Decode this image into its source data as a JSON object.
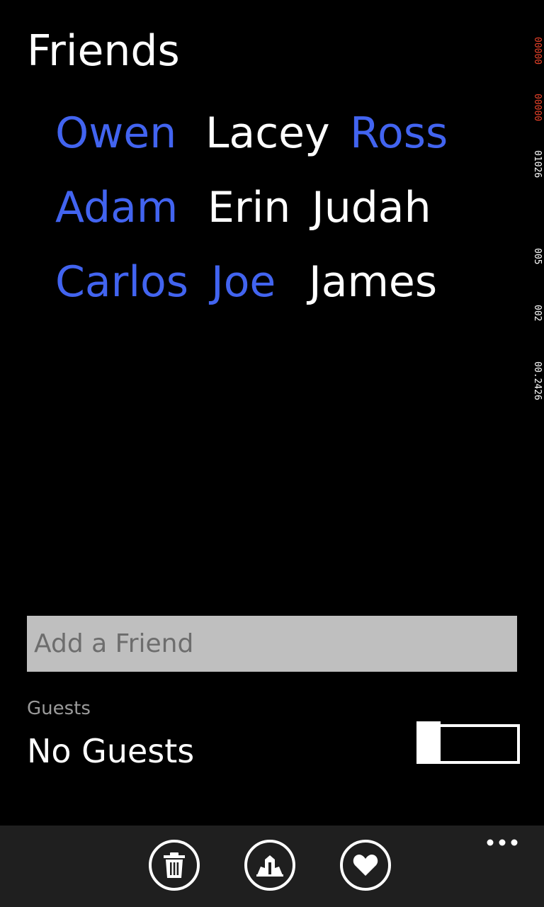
{
  "page": {
    "title": "Friends"
  },
  "friends": {
    "rows": [
      [
        {
          "name": "Owen",
          "selected": true
        },
        {
          "name": "Lacey",
          "selected": false
        },
        {
          "name": "Ross",
          "selected": true
        }
      ],
      [
        {
          "name": "Adam",
          "selected": true
        },
        {
          "name": "Erin",
          "selected": false
        },
        {
          "name": "Judah",
          "selected": false
        }
      ],
      [
        {
          "name": "Carlos",
          "selected": true
        },
        {
          "name": "Joe",
          "selected": true
        },
        {
          "name": "James",
          "selected": false
        }
      ]
    ]
  },
  "perf_counters": [
    "00000",
    "00000",
    "01026",
    "005",
    "002",
    "00.2426"
  ],
  "add_friend": {
    "placeholder": "Add a Friend",
    "value": ""
  },
  "guests": {
    "label": "Guests",
    "value": "No Guests",
    "toggle_on": false
  },
  "app_bar": {
    "buttons": [
      {
        "icon": "trash-icon"
      },
      {
        "icon": "building-icon"
      },
      {
        "icon": "heart-icon"
      }
    ],
    "more_icon": "more-dots-icon"
  },
  "colors": {
    "background": "#000000",
    "accent": "#4264f0",
    "text": "#ffffff",
    "input_bg": "#bfbfbf",
    "app_bar_bg": "#1f1f1f",
    "counter_red": "#e8432a"
  }
}
